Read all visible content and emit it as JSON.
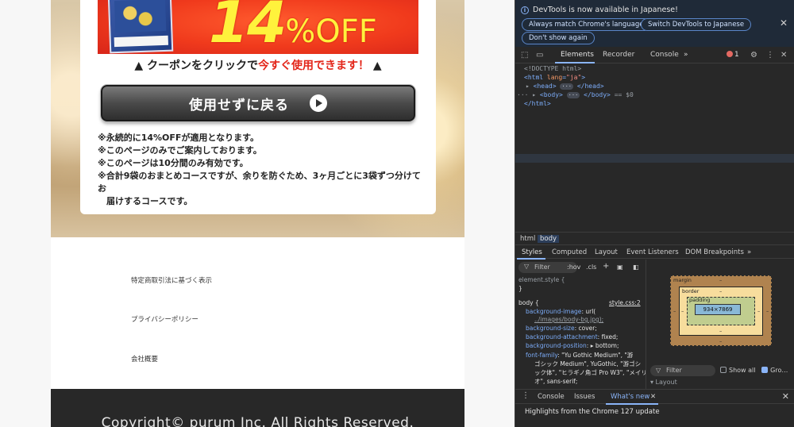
{
  "web_page": {
    "banner": {
      "big_number": "14",
      "percent_text": "%OFF"
    },
    "coupon_note": {
      "prefix": "▲ クーポンをクリックで",
      "highlight": "今すぐ使用できます！",
      "suffix": " ▲"
    },
    "back_button_label": "使用せずに戻る",
    "notes": [
      "※永続的に14%OFFが適用となります。",
      "※このページのみでご案内しております。",
      "※このページは10分間のみ有効です。",
      "※合計9袋のおまとめコースですが、余りを防ぐため、3ヶ月ごとに3袋ずつ分けてお",
      "　届けするコースです。"
    ],
    "footer_links": [
      "特定商取引法に基づく表示",
      "プライバシーポリシー",
      "会社概要"
    ],
    "copyright": "Copyright© purum Inc. All Rights Reserved."
  },
  "devtools": {
    "info_bar": {
      "message": "DevTools is now available in Japanese!",
      "buttons": [
        "Always match Chrome's language",
        "Switch DevTools to Japanese",
        "Don't show again"
      ]
    },
    "tabs": [
      "Elements",
      "Recorder",
      "Console"
    ],
    "more_tabs": "»",
    "error_count": "1",
    "dom": {
      "doctype": "<!DOCTYPE html>",
      "html_open": "<html",
      "lang_attr": "lang",
      "lang_val": "\"ja\"",
      "head": "<head>",
      "head_close": "</head>",
      "body": "<body>",
      "body_close": "</body>",
      "body_ref": "== $0",
      "html_close": "</html>",
      "ellipsis": "···",
      "row_dots": "···"
    },
    "breadcrumbs": [
      "html",
      "body"
    ],
    "sub_tabs": [
      "Styles",
      "Computed",
      "Layout",
      "Event Listeners",
      "DOM Breakpoints"
    ],
    "styles": {
      "filter_label": "Filter",
      "hov": ":hov",
      "cls": ".cls",
      "element_style": "element.style {",
      "close_brace": "}",
      "selector": "body {",
      "source": "style.css:2",
      "rules": [
        {
          "prop": "background-image",
          "val": "url("
        },
        {
          "prop": "",
          "val": "../images/body-bg.jpg);"
        },
        {
          "prop": "background-size",
          "val": "cover;"
        },
        {
          "prop": "background-attachment",
          "val": "fixed;"
        },
        {
          "prop": "background-position",
          "val": "▸ bottom;"
        },
        {
          "prop": "font-family",
          "val": "\"Yu Gothic Medium\", \"游"
        },
        {
          "prop": "",
          "val": "ゴシック Medium\", YuGothic, \"游ゴシ"
        },
        {
          "prop": "",
          "val": "ック体\", \"ヒラギノ角ゴ Pro W3\", \"メイリ"
        },
        {
          "prop": "",
          "val": "オ\", sans-serif;"
        }
      ]
    },
    "box_model": {
      "margin": "margin",
      "border": "border",
      "padding": "padding",
      "content": "934×7869",
      "dash": "–"
    },
    "box_filter_label": "Filter",
    "show_all": "Show all",
    "group": "Gro…",
    "layout_label": "▾ Layout",
    "drawer_tabs": [
      "Console",
      "Issues",
      "What's new"
    ],
    "highlights": "Highlights from the Chrome 127 update"
  }
}
